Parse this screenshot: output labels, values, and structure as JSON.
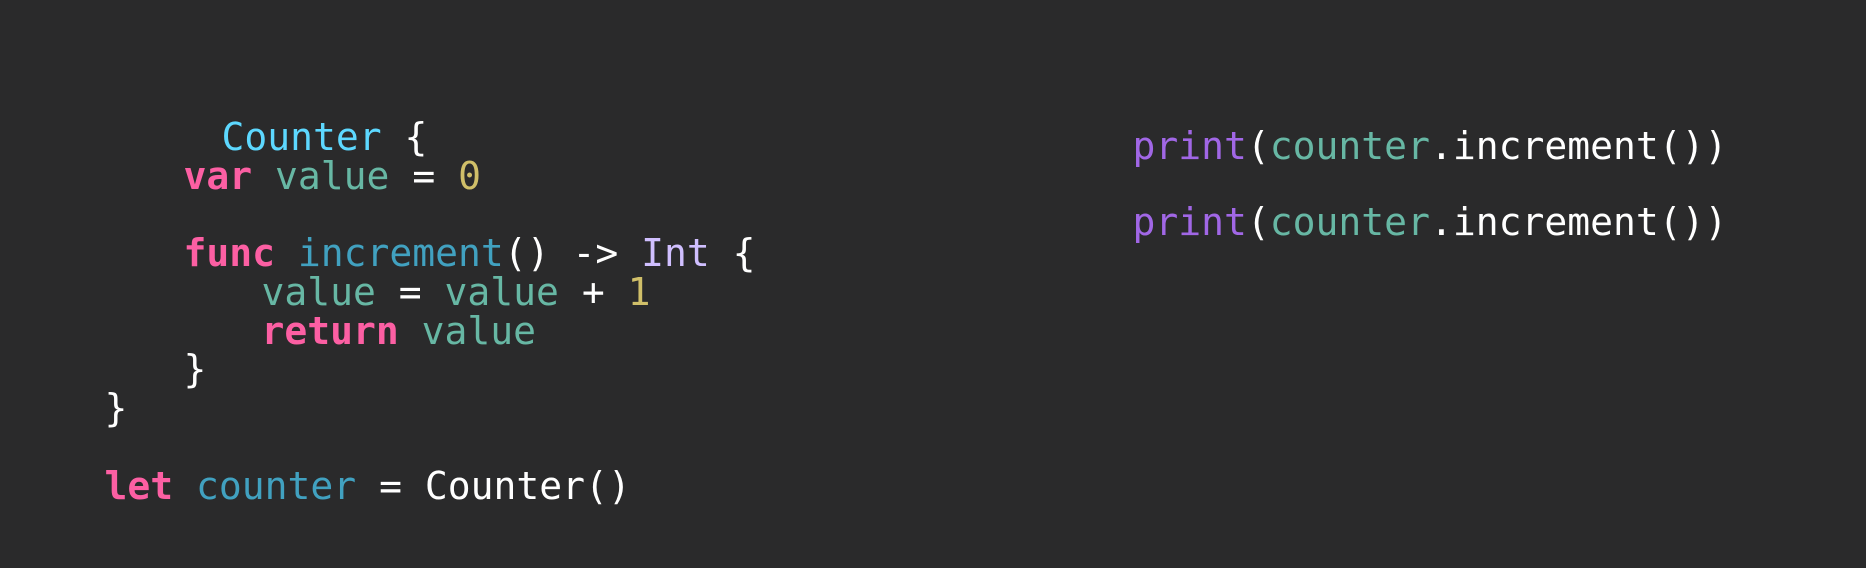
{
  "code": {
    "l1": {
      "name": "Counter",
      "brace": " {"
    },
    "l2": {
      "kw": "var",
      "name": " value",
      "op": " = ",
      "num": "0"
    },
    "l3": {
      "kw": "func",
      "name": " increment",
      "rest": "() -> ",
      "type": "Int",
      "brace": " {"
    },
    "l4": {
      "lhs": "value",
      "op": " = ",
      "rhs": "value",
      "op2": " + ",
      "num": "1"
    },
    "l5": {
      "kw": "return",
      "val": " value"
    },
    "l6": {
      "brace": "}"
    },
    "l7": {
      "brace": "}"
    },
    "l8": {
      "kw": "let",
      "name": " counter",
      "op": " = ",
      "call": "Counter()"
    }
  },
  "output": {
    "p1": {
      "fn": "print",
      "open": "(",
      "obj": "counter",
      "dot": ".",
      "method": "increment",
      "close": "())"
    },
    "p2": {
      "fn": "print",
      "open": "(",
      "obj": "counter",
      "dot": ".",
      "method": "increment",
      "close": "())"
    }
  },
  "colors": {
    "background": "#2a2a2b",
    "keyword": "#fc5fa3",
    "type": "#d0bfff",
    "property": "#67b7a4",
    "function": "#a167e6",
    "number": "#d0bf69",
    "plain": "#ffffff"
  }
}
